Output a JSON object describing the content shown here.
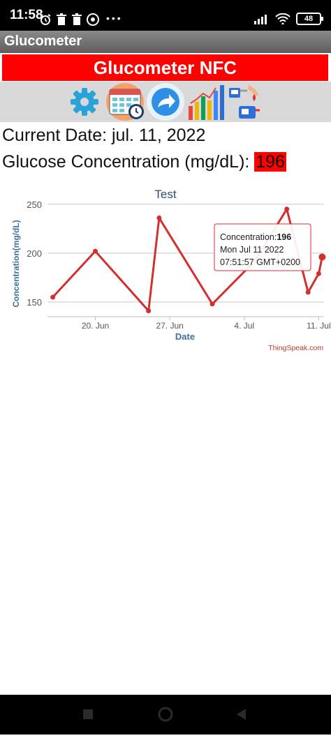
{
  "status_bar": {
    "time": "11:58",
    "battery": "48"
  },
  "app_bar": {
    "title": "Glucometer"
  },
  "banner": {
    "title": "Glucometer NFC"
  },
  "toolbar": {
    "icons": [
      "gear-icon",
      "calendar-clock-icon",
      "share-arrow-icon",
      "bar-chart-icon",
      "glucose-meter-icon"
    ]
  },
  "info": {
    "current_date_label": "Current Date: jul. 11, 2022",
    "glucose_label": "Glucose Concentration (mg/dL): ",
    "glucose_value": "196"
  },
  "chart_data": {
    "type": "line",
    "title": "Test",
    "xlabel": "Date",
    "ylabel": "Concentration(mg/dL)",
    "x_ticks": [
      "20. Jun",
      "27. Jun",
      "4. Jul",
      "11. Jul"
    ],
    "y_ticks": [
      150,
      200,
      250
    ],
    "ylim": [
      135,
      252
    ],
    "x": [
      "2022-06-16",
      "2022-06-20",
      "2022-06-25",
      "2022-06-26",
      "2022-07-01",
      "2022-07-05",
      "2022-07-08",
      "2022-07-10",
      "2022-07-11",
      "2022-07-11 07:51:57"
    ],
    "series": [
      {
        "values": [
          155,
          202,
          141,
          236,
          148,
          192,
          245,
          160,
          179,
          196
        ]
      }
    ],
    "tooltip": {
      "label": "Concentration:",
      "value": "196",
      "date": "Mon Jul 11 2022",
      "time": "07:51:57 GMT+0200"
    },
    "credit": "ThingSpeak.com",
    "series_color": "#d32f2f",
    "grid": true,
    "legend": "none"
  }
}
